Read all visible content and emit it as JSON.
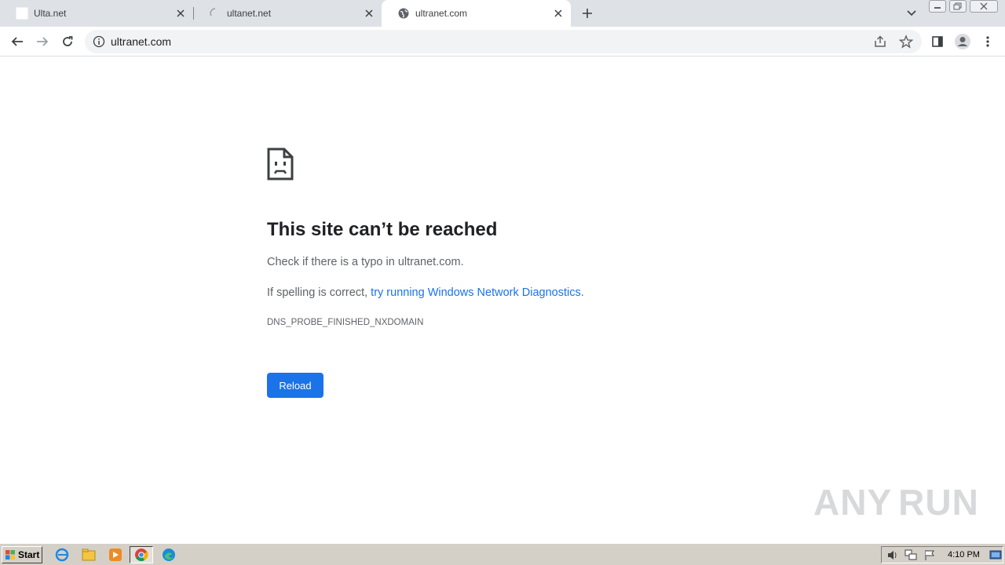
{
  "tabs": [
    {
      "title": "Ulta.net",
      "favicon": "blank-page-icon"
    },
    {
      "title": "ultanet.net",
      "favicon": "loading-spinner-icon"
    },
    {
      "title": "ultranet.com",
      "favicon": "globe-icon",
      "active": true
    }
  ],
  "omnibox": {
    "url": "ultranet.com"
  },
  "error_page": {
    "title": "This site can’t be reached",
    "line1": "Check if there is a typo in ultranet.com.",
    "line2_prefix": "If spelling is correct, ",
    "line2_link": "try running Windows Network Diagnostics",
    "line2_suffix": ".",
    "error_code": "DNS_PROBE_FINISHED_NXDOMAIN",
    "reload_label": "Reload"
  },
  "watermark": {
    "left": "ANY",
    "right": "RUN"
  },
  "taskbar": {
    "start_label": "Start",
    "clock": "4:10 PM"
  },
  "colors": {
    "accent": "#1a73e8",
    "tabstrip": "#dee1e6",
    "taskbar": "#d4d0c8"
  }
}
